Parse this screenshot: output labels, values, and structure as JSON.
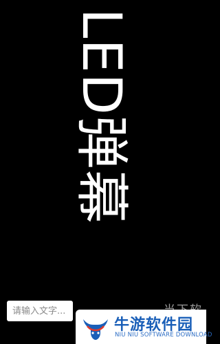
{
  "led": {
    "text": "LED弹幕",
    "text_color": "#ffffff",
    "background_color": "#000000",
    "orientation": "vertical-rotated-90"
  },
  "watermark": {
    "fragment_text": "当下软件园"
  },
  "input": {
    "placeholder": "请输入文字...",
    "value": ""
  },
  "logo": {
    "title": "牛游软件园",
    "subtitle": "NIU NIU SOFTWARE DOWNLOAD",
    "brand_color": "#1a5fb8",
    "icon": "bull-logo-icon"
  }
}
